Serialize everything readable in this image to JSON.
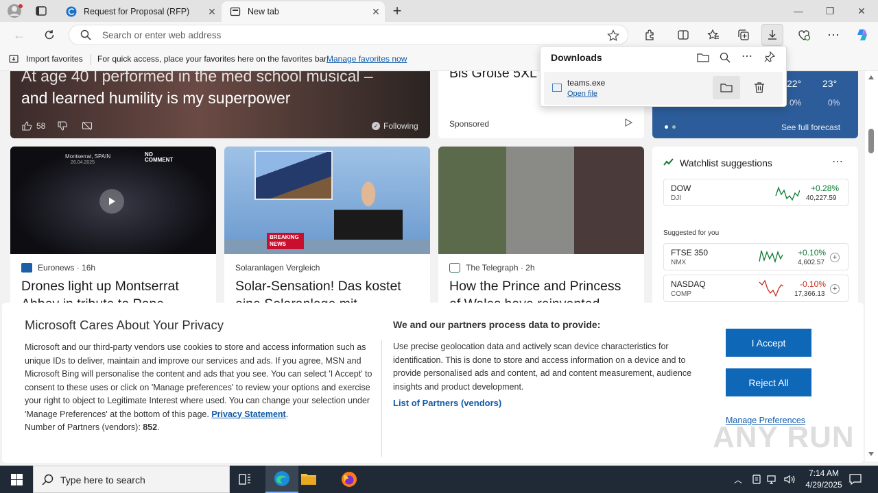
{
  "browser": {
    "tabs": [
      {
        "title": "Request for Proposal (RFP)",
        "active": false
      },
      {
        "title": "New tab",
        "active": true
      }
    ],
    "address_placeholder": "Search or enter web address",
    "favorites_bar": {
      "import_label": "Import favorites",
      "message": "For quick access, place your favorites here on the favorites bar.",
      "link": "Manage favorites now"
    }
  },
  "downloads": {
    "title": "Downloads",
    "item": {
      "filename": "teams.exe",
      "action": "Open file"
    }
  },
  "feed": {
    "hero": {
      "headline_line1": "At age 40 I performed in the med school musical –",
      "headline_line2": "and learned humility is my superpower",
      "likes": "58",
      "following": "Following"
    },
    "sponsored_top": {
      "headline": "Bis Größe 5XL",
      "label": "Sponsored"
    },
    "weather": {
      "temp1": "22°",
      "temp2": "23°",
      "precip1": "0%",
      "precip2": "0%",
      "link": "See full forecast"
    },
    "cards": [
      {
        "source": "Euronews",
        "time": "16h",
        "headline_line1": "Drones light up Montserrat",
        "headline_line2": "Abbey in tribute to Pope",
        "video_overlay": "Montserrat, SPAIN",
        "video_date": "26.04.2025",
        "video_brand": "NO COMMENT"
      },
      {
        "source": "Solaranlagen Vergleich",
        "time": "",
        "headline_line1": "Solar-Sensation! Das kostet",
        "headline_line2": "eine Solaranlage mit",
        "badge": "BREAKING NEWS"
      },
      {
        "source": "The Telegraph",
        "time": "2h",
        "headline_line1": "How the Prince and Princess",
        "headline_line2": "of Wales have reinvented"
      }
    ],
    "watchlist": {
      "title": "Watchlist suggestions",
      "primary": {
        "symbol": "DOW",
        "sub": "DJI",
        "change": "+0.28%",
        "value": "40,227.59",
        "color": "#0a7a2f"
      },
      "suggested_label": "Suggested for you",
      "items": [
        {
          "symbol": "FTSE 350",
          "sub": "NMX",
          "change": "+0.10%",
          "value": "4,602.57",
          "color": "#0a7a2f"
        },
        {
          "symbol": "NASDAQ",
          "sub": "COMP",
          "change": "-0.10%",
          "value": "17,366.13",
          "color": "#c42b1c"
        }
      ]
    }
  },
  "privacy": {
    "title": "Microsoft Cares About Your Privacy",
    "body": "Microsoft and our third-party vendors use cookies to store and access information such as unique IDs to deliver, maintain and improve our services and ads. If you agree, MSN and Microsoft Bing will personalise the content and ads that you see. You can select 'I Accept' to consent to these uses or click on 'Manage preferences' to review your options and exercise your right to object to Legitimate Interest where used.  You can change your selection under 'Manage Preferences' at the bottom of this page.",
    "privacy_link": "Privacy Statement",
    "partners_prefix": "Number of Partners (vendors):",
    "partners_count": "852",
    "right_title": "We and our partners process data to provide:",
    "right_body": "Use precise geolocation data and actively scan device characteristics for identification. This is done to store and access information on a device and to provide personalised ads and content, ad and content measurement, audience insights and product development.",
    "partners_link": "List of Partners (vendors)",
    "accept": "I Accept",
    "reject": "Reject All",
    "manage": "Manage Preferences"
  },
  "watermark": "ANY RUN",
  "taskbar": {
    "search_placeholder": "Type here to search",
    "time": "7:14 AM",
    "date": "4/29/2025"
  },
  "colors": {
    "accent": "#0f67b8",
    "link": "#0f5aa8",
    "taskbar": "#1f2a36"
  }
}
